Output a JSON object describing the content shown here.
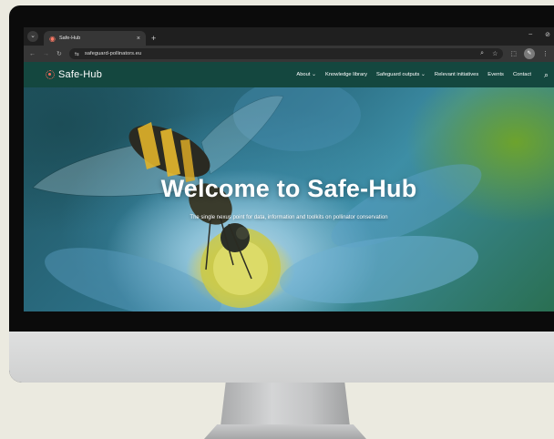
{
  "browser": {
    "tab_title": "Safe-Hub",
    "tab_close": "×",
    "new_tab": "+",
    "url": "safeguard-pollinators.eu",
    "window_minimize": "–",
    "window_close": "⊘"
  },
  "site": {
    "logo_text": "Safe-Hub",
    "nav": [
      "About ⌄",
      "Knowledge library",
      "Safeguard outputs ⌄",
      "Relevant initiatives",
      "Events",
      "Contact"
    ],
    "brand_color": "#14473f",
    "accent_color": "#ff6b5b"
  },
  "hero": {
    "title": "Welcome to Safe-Hub",
    "subtitle": "The single nexus point for data, information and toolkits on pollinator conservation"
  },
  "icons": {
    "back": "←",
    "forward": "→",
    "reload": "↻",
    "site_info": "⇆",
    "zoom": "🔍",
    "bookmark": "☆",
    "extensions": "⬚",
    "profile": "✎",
    "more": "⋮",
    "search": "⚲"
  }
}
